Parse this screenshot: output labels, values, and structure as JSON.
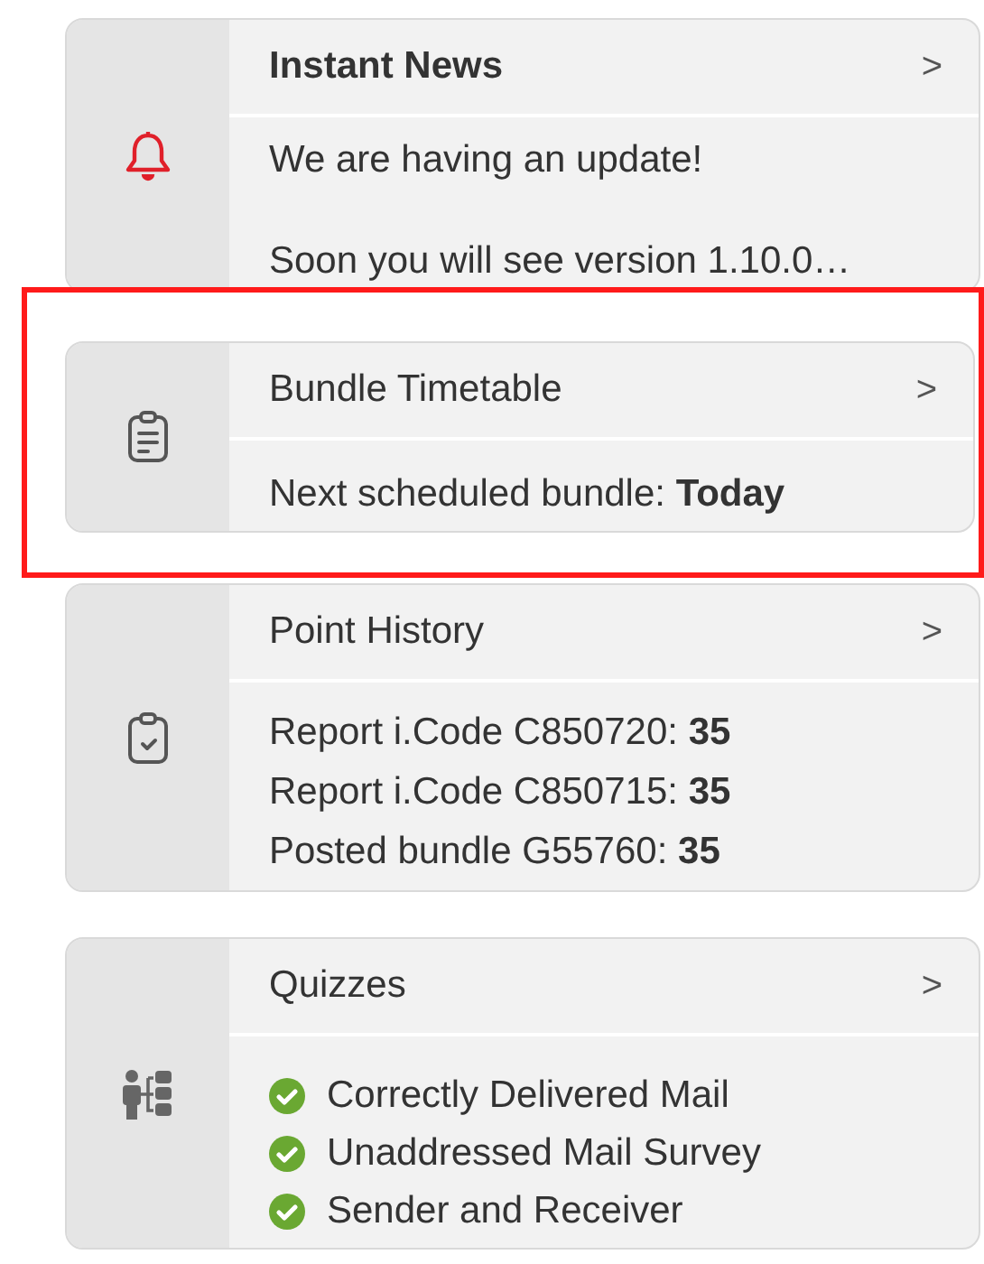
{
  "cards": [
    {
      "kind": "news",
      "title": "Instant News",
      "unread": true,
      "highlighted": false,
      "chevron": ">",
      "lines": [
        {
          "kind": "text",
          "text": "We are having an update!"
        },
        {
          "kind": "text",
          "text": "Soon you will see version 1.10.0…"
        }
      ]
    },
    {
      "kind": "timetable",
      "title": "Bundle Timetable",
      "unread": false,
      "highlighted": true,
      "chevron": ">",
      "lines": [
        {
          "kind": "text",
          "text": "Next scheduled bundle: **Today**"
        }
      ]
    },
    {
      "kind": "history",
      "title": "Point History",
      "unread": false,
      "highlighted": false,
      "chevron": ">",
      "lines": [
        {
          "kind": "text",
          "text": "Report i.Code C850720: **35**"
        },
        {
          "kind": "text",
          "text": "Report i.Code C850715: **35**"
        },
        {
          "kind": "text",
          "text": "Posted bundle G55760: **35**"
        }
      ]
    },
    {
      "kind": "quiz",
      "title": "Quizzes",
      "unread": false,
      "highlighted": false,
      "chevron": ">",
      "lines": [
        {
          "kind": "check",
          "text": "Correctly Delivered Mail",
          "checked": true
        },
        {
          "kind": "check",
          "text": "Unaddressed Mail Survey",
          "checked": true
        },
        {
          "kind": "check",
          "text": "Sender and Receiver",
          "checked": true
        }
      ]
    }
  ]
}
